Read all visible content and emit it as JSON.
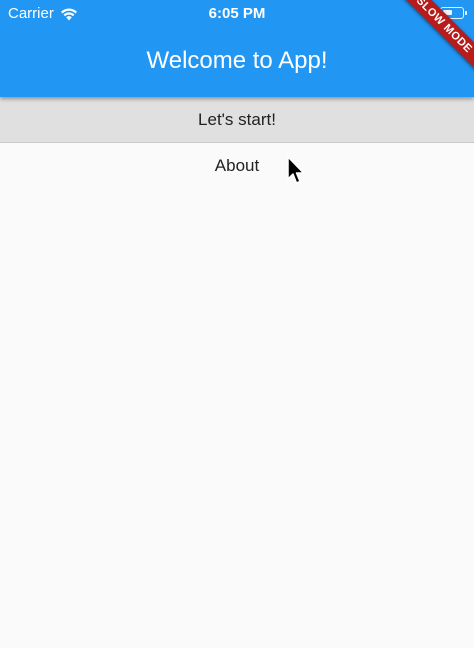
{
  "status_bar": {
    "carrier": "Carrier",
    "time": "6:05 PM",
    "battery_level": 0.5,
    "icons": [
      "wifi-icon",
      "battery-icon"
    ]
  },
  "app_bar": {
    "title": "Welcome to App!",
    "background_color": "#2196f3",
    "debug_banner": "SLOW MODE",
    "debug_banner_color": "#b71c1c"
  },
  "body": {
    "start_label": "Let's start!",
    "about_label": "About",
    "background_color": "#fafafa"
  },
  "pointer": {
    "icon": "cursor-arrow-icon"
  }
}
